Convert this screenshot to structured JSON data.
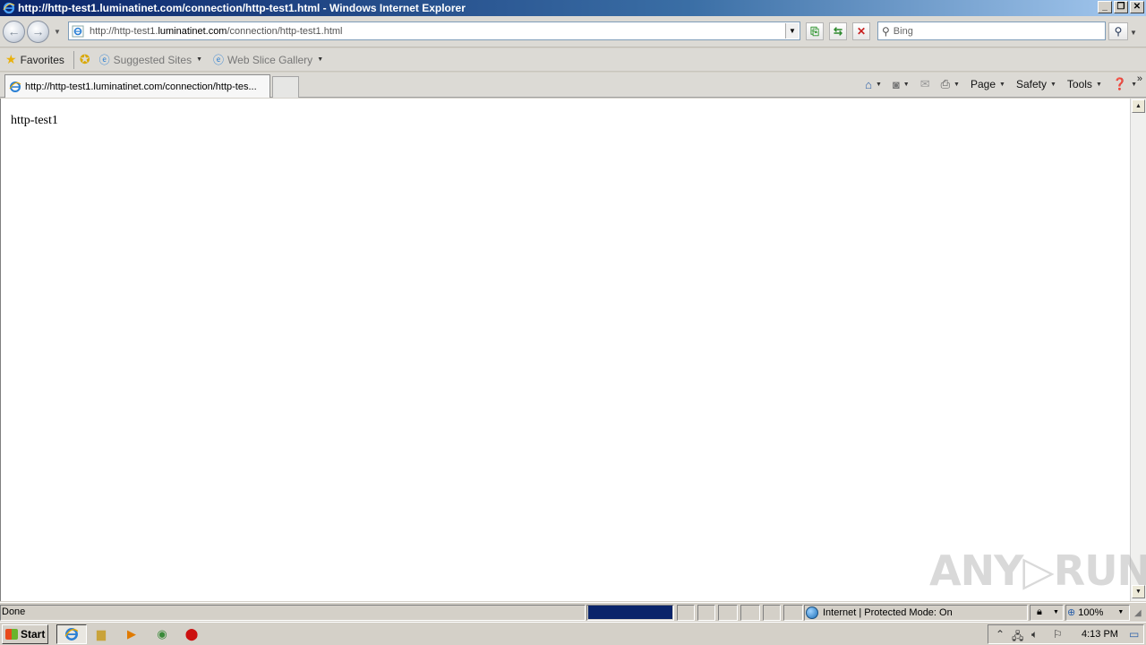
{
  "window": {
    "title": "http://http-test1.luminatinet.com/connection/http-test1.html - Windows Internet Explorer",
    "controls": {
      "minimize": "_",
      "restore": "❐",
      "close": "✕"
    }
  },
  "navigation": {
    "url_prefix": "http://http-test1.",
    "url_domain": "luminatinet.com",
    "url_suffix": "/connection/http-test1.html",
    "search_placeholder": "Bing"
  },
  "favorites_bar": {
    "favorites_label": "Favorites",
    "items": [
      {
        "label": "Suggested Sites"
      },
      {
        "label": "Web Slice Gallery"
      }
    ]
  },
  "tabs": [
    {
      "label": "http://http-test1.luminatinet.com/connection/http-tes..."
    }
  ],
  "command_bar": {
    "page": "Page",
    "safety": "Safety",
    "tools": "Tools"
  },
  "content": {
    "text": "http-test1"
  },
  "watermark": "ANY▷RUN",
  "status_bar": {
    "status": "Done",
    "zone": "Internet | Protected Mode: On",
    "zoom": "100%"
  },
  "taskbar": {
    "start_label": "Start",
    "clock": "4:13 PM"
  },
  "colors": {
    "title_gradient_start": "#0a246a",
    "progress": "#0a246a",
    "chrome": "#d4d0c8"
  }
}
